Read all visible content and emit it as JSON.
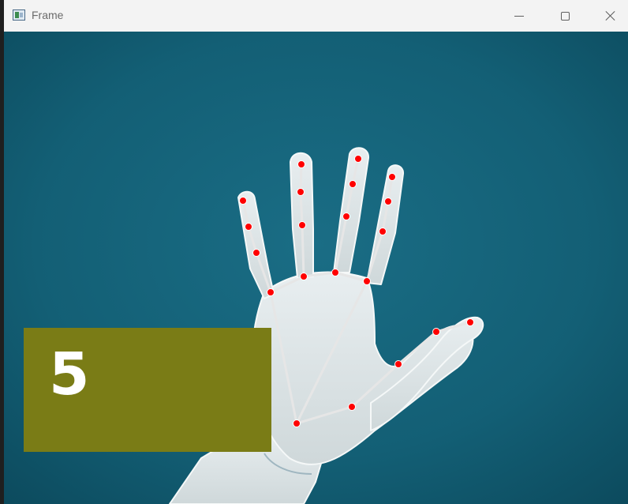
{
  "window": {
    "title": "Frame"
  },
  "icons": {
    "app": "app-window-icon",
    "minimize": "minimize-icon",
    "maximize": "maximize-icon",
    "close": "close-icon"
  },
  "overlay": {
    "finger_count": "5"
  },
  "colors": {
    "background": "#136178",
    "landmark": "#ff0000",
    "connection": "#e6e6e6",
    "count_box": "#7a7c16",
    "count_text": "#ffffff"
  }
}
